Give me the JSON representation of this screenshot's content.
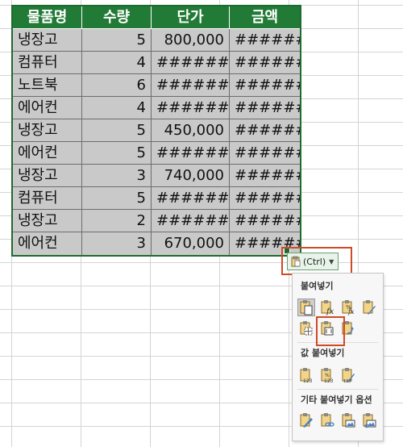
{
  "table": {
    "headers": [
      "물품명",
      "수량",
      "단가",
      "금액"
    ],
    "rows": [
      [
        "냉장고",
        "5",
        "800,000",
        "######"
      ],
      [
        "컴퓨터",
        "4",
        "######",
        "######"
      ],
      [
        "노트북",
        "6",
        "######",
        "######"
      ],
      [
        "에어컨",
        "4",
        "######",
        "######"
      ],
      [
        "냉장고",
        "5",
        "450,000",
        "######"
      ],
      [
        "에어컨",
        "5",
        "######",
        "######"
      ],
      [
        "냉장고",
        "3",
        "740,000",
        "######"
      ],
      [
        "컴퓨터",
        "5",
        "######",
        "######"
      ],
      [
        "냉장고",
        "2",
        "######",
        "######"
      ],
      [
        "에어컨",
        "3",
        "670,000",
        "######"
      ]
    ],
    "header_bg": "#217a35",
    "cell_bg": "#c9c9c9"
  },
  "paste_options_button": {
    "label": "(Ctrl)",
    "icon": "clipboard-icon"
  },
  "paste_menu": {
    "section_paste": "붙여넣기",
    "section_values": "값 붙여넣기",
    "section_other": "기타 붙여넣기 옵션",
    "paste_icons": [
      "paste-icon",
      "paste-formulas-icon",
      "paste-formulas-number-format-icon",
      "paste-keep-source-format-icon",
      "paste-no-borders-icon",
      "paste-keep-column-widths-icon",
      "paste-transpose-icon"
    ],
    "value_icons": [
      "paste-values-icon",
      "paste-values-number-format-icon",
      "paste-values-source-format-icon"
    ],
    "other_icons": [
      "paste-formatting-icon",
      "paste-link-icon",
      "paste-picture-icon",
      "paste-linked-picture-icon"
    ]
  },
  "highlight_color": "#d14a24"
}
